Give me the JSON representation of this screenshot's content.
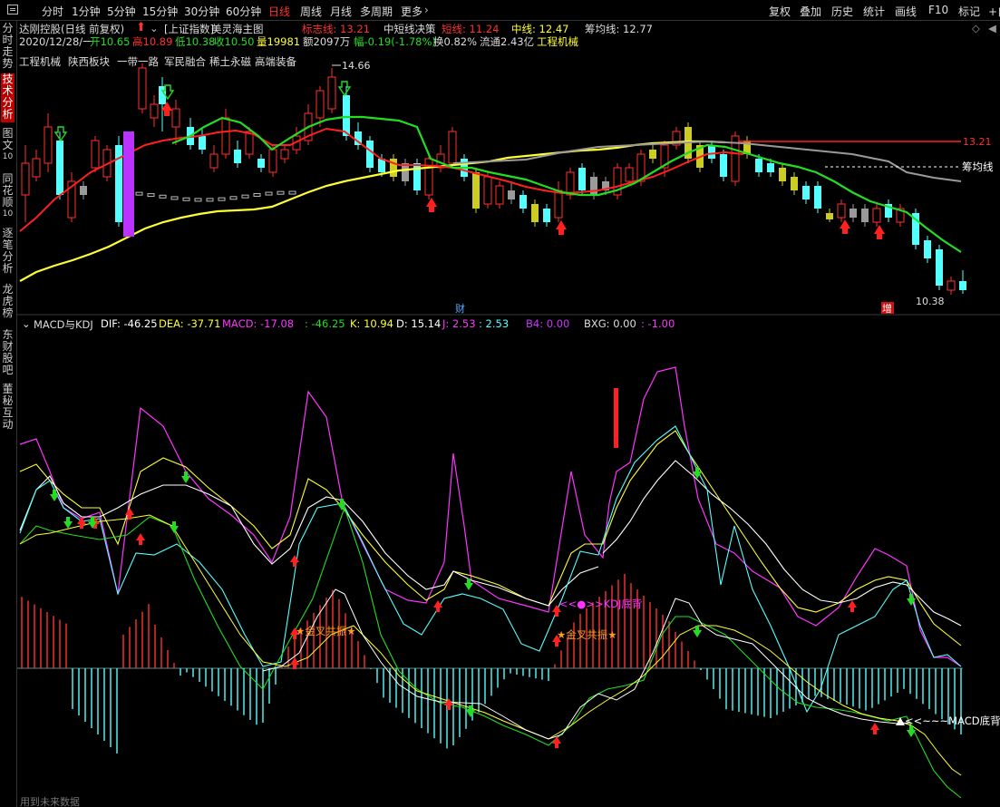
{
  "toolbar": {
    "periods": [
      "分时",
      "1分钟",
      "5分钟",
      "15分钟",
      "30分钟",
      "60分钟",
      "日线",
      "周线",
      "月线",
      "多周期",
      "更多"
    ],
    "active_period": "日线",
    "more_arrow": "›",
    "right_items": [
      "复权",
      "叠加",
      "历史",
      "统计",
      "画线",
      "F10",
      "标记",
      "+自"
    ]
  },
  "sidebar": {
    "items": [
      {
        "label": "分时走势",
        "active": false
      },
      {
        "label": "技术分析",
        "active": true
      },
      {
        "label": "图文",
        "sub": "10",
        "active": false
      },
      {
        "label": "同花顺",
        "sub": "10",
        "active": false
      },
      {
        "label": "逐笔分析",
        "active": false
      },
      {
        "label": "龙虎榜",
        "active": false
      },
      {
        "label": "东财股吧",
        "active": false
      },
      {
        "label": "董秘互动",
        "active": false
      }
    ]
  },
  "header": {
    "stock_name": "达刚控股(日线 前复权)",
    "indicator_prefix": "[上证指数]",
    "indicator_name": "美灵海主图",
    "mark_label": "标志线: 13.21",
    "decision_label": "中短线决策",
    "short_label": "短线: 11.24",
    "mid_label": "中线: 12.47",
    "chip_label": "筹均线: 12.77",
    "date": "2020/12/28/一",
    "open": "开10.65",
    "high": "高10.89",
    "low": "低10.38",
    "close": "收10.50",
    "volume": "量19981",
    "amount": "额2097万",
    "change": "幅-0.19(-1.78%)",
    "turnover": "换0.82%",
    "float_cap": "流通2.43亿",
    "industry": "工程机械"
  },
  "concepts": [
    "工程机械",
    "陕西板块",
    "一带一路",
    "军民融合",
    "稀土永磁",
    "高端装备"
  ],
  "price_labels": {
    "max": "14.66",
    "min": "10.38",
    "mark_value": "13.21",
    "chip_name": "筹均线",
    "event_cai": "财",
    "event_zeng": "增"
  },
  "lower_header": {
    "name": "MACD与KDJ",
    "dif": "DIF: -46.25",
    "dea": "DEA: -37.71",
    "macd": "MACD: -17.08",
    "extra1": ": -46.25",
    "k": "K: 10.94",
    "d": "D: 15.14",
    "j": "J: 2.53",
    "extra2": ": 2.53",
    "b4": "B4: 0.00",
    "bxg": "BXG: 0.00",
    "extra3": ": -1.00"
  },
  "annotations": {
    "golden1": "★金叉共振★",
    "golden2": "★金叉共振★",
    "kdj_div": "<<●>>KDJ底背",
    "macd_div": "<<~~~MACD底背"
  },
  "footer": "用到未来数据",
  "colors": {
    "up": "#ff3030",
    "down": "#54ffff",
    "short_line": "#ff2020",
    "mid_line": "#22dd22",
    "yellow_line": "#ffff33",
    "chip_line": "#9a9a9a",
    "k_line": "#ffffff",
    "d_line": "#ffff33",
    "j_line": "#ff33ff",
    "dif_line": "#ffffff"
  },
  "chart_data": [
    {
      "type": "candlestick",
      "title": "美灵海主图",
      "ylim": [
        10.2,
        15.0
      ],
      "last_bar": {
        "open": 10.65,
        "high": 10.89,
        "low": 10.38,
        "close": 10.5
      },
      "series": [
        {
          "name": "短线",
          "last": 11.24
        },
        {
          "name": "中线",
          "last": 12.47
        },
        {
          "name": "筹均线",
          "last": 12.77
        },
        {
          "name": "标志线",
          "last": 13.21
        }
      ],
      "annotations": [
        "14.66",
        "10.38",
        "13.21",
        "筹均线"
      ]
    },
    {
      "type": "line",
      "title": "MACD与KDJ",
      "series": [
        {
          "name": "DIF",
          "last": -46.25
        },
        {
          "name": "DEA",
          "last": -37.71
        },
        {
          "name": "MACD",
          "last": -17.08
        },
        {
          "name": "K",
          "last": 10.94
        },
        {
          "name": "D",
          "last": 15.14
        },
        {
          "name": "J",
          "last": 2.53
        }
      ]
    }
  ]
}
